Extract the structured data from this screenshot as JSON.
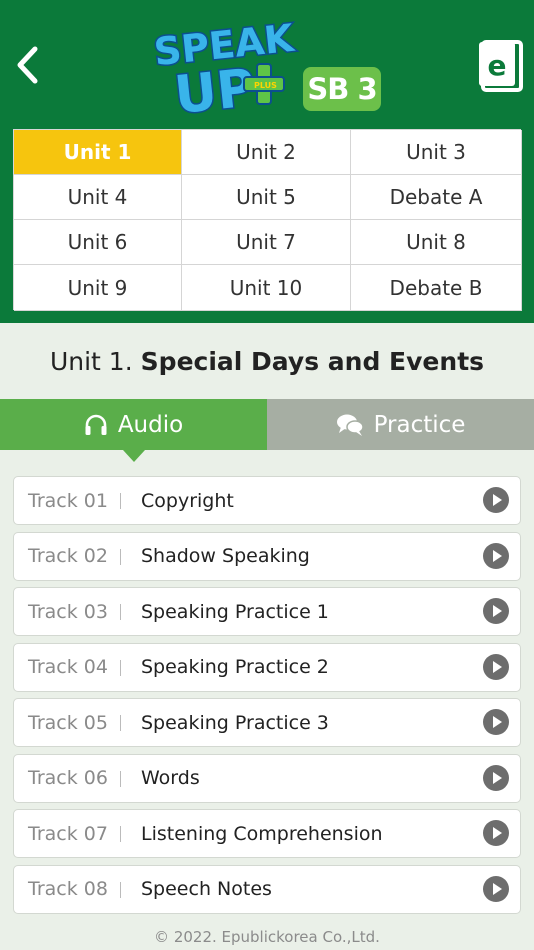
{
  "header": {
    "logo_text_line1": "SPEAK",
    "logo_text_line2": "UP",
    "logo_plus": "PLUS",
    "book_badge": "SB 3",
    "ebook_letter": "e"
  },
  "units": [
    {
      "label": "Unit 1",
      "active": true
    },
    {
      "label": "Unit 2",
      "active": false
    },
    {
      "label": "Unit 3",
      "active": false
    },
    {
      "label": "Unit 4",
      "active": false
    },
    {
      "label": "Unit 5",
      "active": false
    },
    {
      "label": "Debate A",
      "active": false
    },
    {
      "label": "Unit 6",
      "active": false
    },
    {
      "label": "Unit 7",
      "active": false
    },
    {
      "label": "Unit 8",
      "active": false
    },
    {
      "label": "Unit 9",
      "active": false
    },
    {
      "label": "Unit 10",
      "active": false
    },
    {
      "label": "Debate B",
      "active": false
    }
  ],
  "page_title": {
    "prefix": "Unit 1.",
    "name": "Special Days and Events"
  },
  "tabs": {
    "audio": "Audio",
    "practice": "Practice"
  },
  "tracks": [
    {
      "num": "Track 01",
      "title": "Copyright"
    },
    {
      "num": "Track 02",
      "title": "Shadow Speaking"
    },
    {
      "num": "Track 03",
      "title": "Speaking Practice 1"
    },
    {
      "num": "Track 04",
      "title": "Speaking Practice 2"
    },
    {
      "num": "Track 05",
      "title": "Speaking Practice 3"
    },
    {
      "num": "Track 06",
      "title": "Words"
    },
    {
      "num": "Track 07",
      "title": "Listening Comprehension"
    },
    {
      "num": "Track 08",
      "title": "Speech Notes"
    }
  ],
  "footer": "© 2022. Epublickorea Co.,Ltd.",
  "colors": {
    "header_green": "#0b7a3a",
    "active_unit": "#f6c50e",
    "audio_tab": "#5aae4a",
    "practice_tab": "#a6aea3",
    "badge_green": "#6cc04a"
  }
}
